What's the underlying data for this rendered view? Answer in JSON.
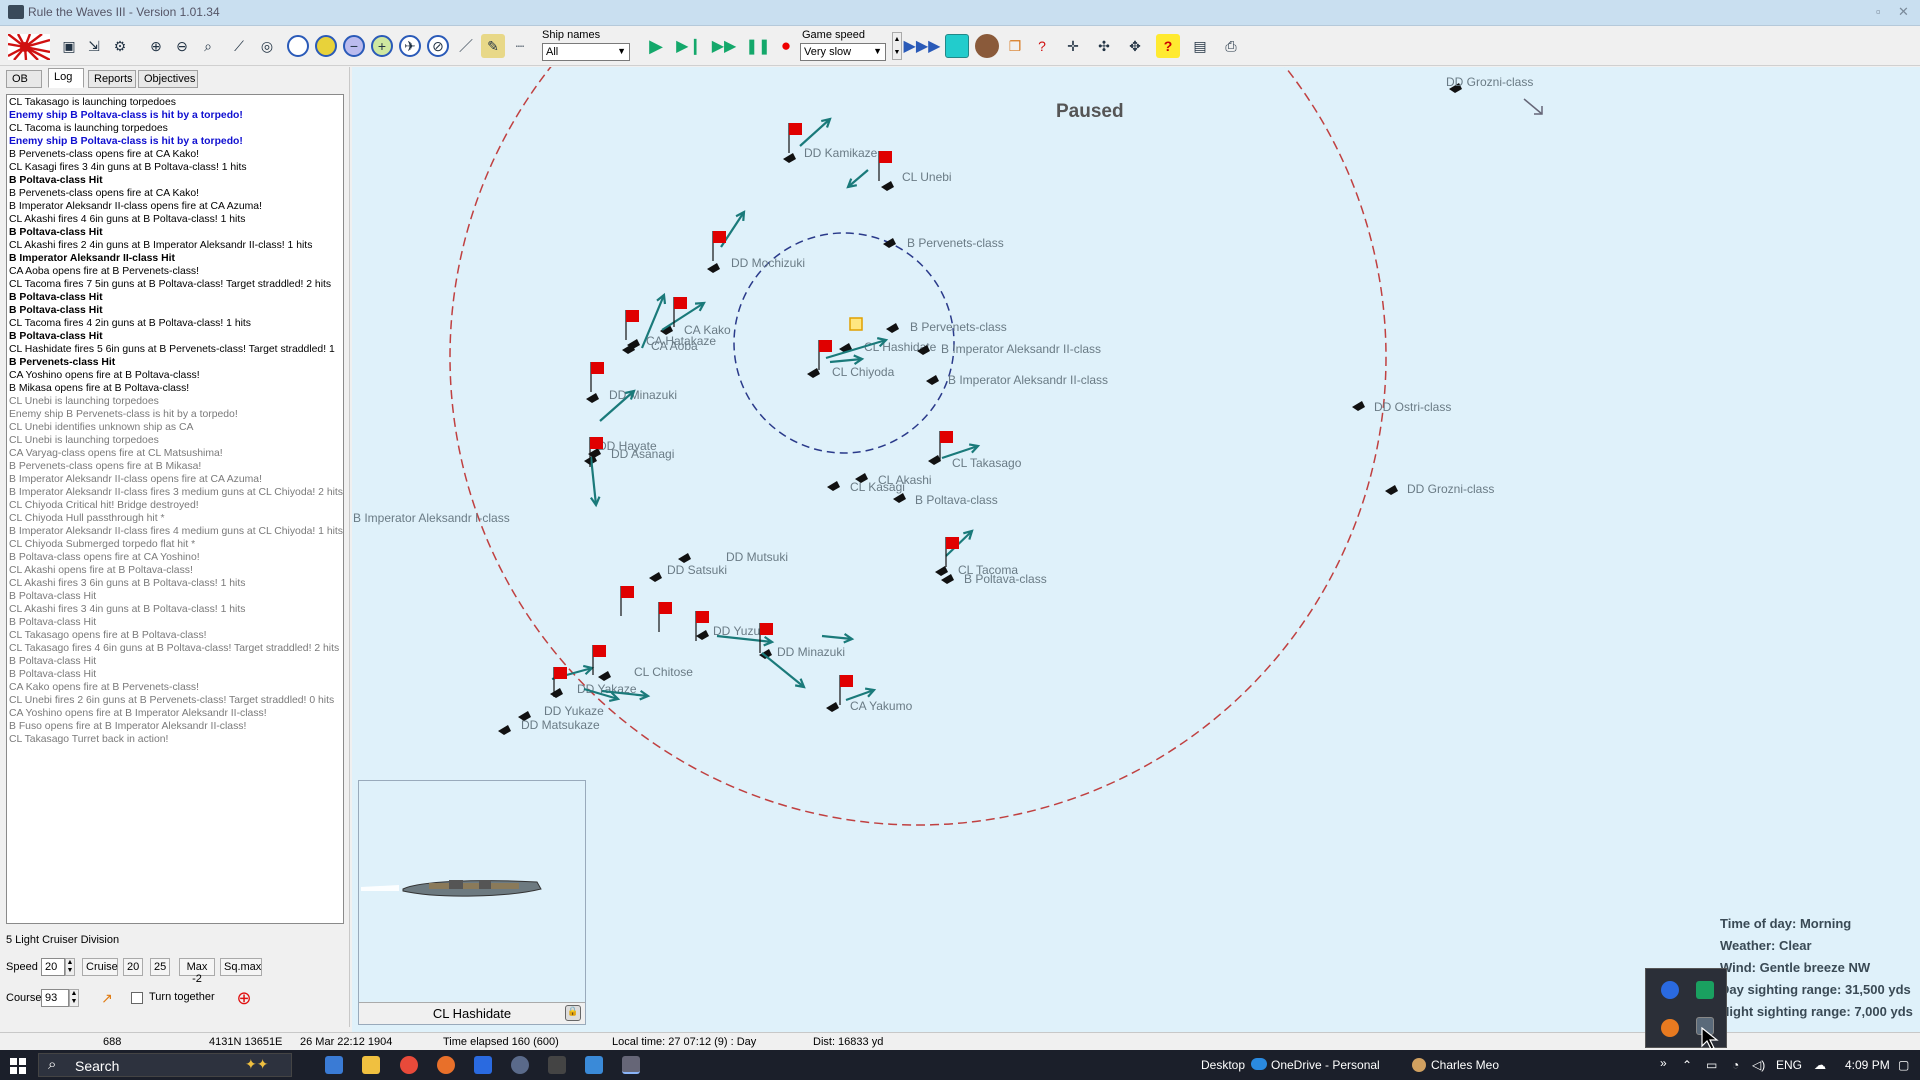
{
  "window": {
    "title": "Rule the Waves III - Version 1.01.34"
  },
  "toolbar": {
    "ship_names_label": "Ship names",
    "ship_names_value": "All",
    "game_speed_label": "Game speed",
    "game_speed_value": "Very slow"
  },
  "tabs": [
    {
      "label": "OB"
    },
    {
      "label": "Log"
    },
    {
      "label": "Reports"
    },
    {
      "label": "Objectives"
    }
  ],
  "log": [
    {
      "text": "CL Takasago is launching torpedoes",
      "style": "normal"
    },
    {
      "text": "Enemy ship B Poltava-class is hit by a torpedo!",
      "style": "blue"
    },
    {
      "text": "CL Tacoma is launching torpedoes",
      "style": "normal"
    },
    {
      "text": "Enemy ship B Poltava-class is hit by a torpedo!",
      "style": "blue"
    },
    {
      "text": "B Pervenets-class opens fire at CA Kako!",
      "style": "normal"
    },
    {
      "text": "CL Kasagi fires 3 4in guns at B Poltava-class! 1 hits",
      "style": "normal"
    },
    {
      "text": "B Poltava-class Hit",
      "style": "bold"
    },
    {
      "text": "B Pervenets-class opens fire at CA Kako!",
      "style": "normal"
    },
    {
      "text": "B Imperator Aleksandr II-class opens fire at CA Azuma!",
      "style": "normal"
    },
    {
      "text": "CL Akashi fires 4 6in guns at B Poltava-class! 1 hits",
      "style": "normal"
    },
    {
      "text": "B Poltava-class Hit",
      "style": "bold"
    },
    {
      "text": "CL Akashi fires 2 4in guns at B Imperator Aleksandr II-class! 1 hits",
      "style": "normal"
    },
    {
      "text": "B Imperator Aleksandr II-class Hit",
      "style": "bold"
    },
    {
      "text": "CA Aoba opens fire at B Pervenets-class!",
      "style": "normal"
    },
    {
      "text": "CL Tacoma fires 7 5in guns at B Poltava-class! Target straddled!  2 hits",
      "style": "normal"
    },
    {
      "text": "B Poltava-class Hit",
      "style": "bold"
    },
    {
      "text": "B Poltava-class Hit",
      "style": "bold"
    },
    {
      "text": "CL Tacoma fires 4 2in guns at B Poltava-class! 1 hits",
      "style": "normal"
    },
    {
      "text": "B Poltava-class Hit",
      "style": "bold"
    },
    {
      "text": "CL Hashidate fires 5 6in guns at B Pervenets-class! Target straddled!  1",
      "style": "normal"
    },
    {
      "text": "B Pervenets-class Hit",
      "style": "bold"
    },
    {
      "text": "CA Yoshino opens fire at B Poltava-class!",
      "style": "normal"
    },
    {
      "text": "B Mikasa opens fire at B Poltava-class!",
      "style": "normal"
    },
    {
      "text": "CL Unebi is launching torpedoes",
      "style": "grey"
    },
    {
      "text": "Enemy ship B Pervenets-class is hit by a torpedo!",
      "style": "grey"
    },
    {
      "text": "CL Unebi identifies unknown ship as CA",
      "style": "grey"
    },
    {
      "text": "CL Unebi is launching torpedoes",
      "style": "grey"
    },
    {
      "text": "CA Varyag-class opens fire at CL Matsushima!",
      "style": "grey"
    },
    {
      "text": "B Pervenets-class opens fire at B Mikasa!",
      "style": "grey"
    },
    {
      "text": "B Imperator Aleksandr II-class opens fire at CA Azuma!",
      "style": "grey"
    },
    {
      "text": "B Imperator Aleksandr II-class fires 3 medium guns at CL Chiyoda! 2 hits",
      "style": "grey"
    },
    {
      "text": "CL Chiyoda  Critical hit! Bridge destroyed!",
      "style": "grey"
    },
    {
      "text": "CL Chiyoda Hull passthrough hit *",
      "style": "grey"
    },
    {
      "text": "B Imperator Aleksandr II-class fires 4 medium guns at CL Chiyoda! 1 hits",
      "style": "grey"
    },
    {
      "text": "CL Chiyoda Submerged torpedo flat hit *",
      "style": "grey"
    },
    {
      "text": "B Poltava-class opens fire at CA Yoshino!",
      "style": "grey"
    },
    {
      "text": "CL Akashi opens fire at B Poltava-class!",
      "style": "grey"
    },
    {
      "text": "CL Akashi fires 3 6in guns at B Poltava-class! 1 hits",
      "style": "grey"
    },
    {
      "text": "B Poltava-class Hit",
      "style": "grey"
    },
    {
      "text": "CL Akashi fires 3 4in guns at B Poltava-class! 1 hits",
      "style": "grey"
    },
    {
      "text": "B Poltava-class Hit",
      "style": "grey"
    },
    {
      "text": "CL Takasago opens fire at B Poltava-class!",
      "style": "grey"
    },
    {
      "text": "CL Takasago fires 4 6in guns at B Poltava-class! Target straddled!  2 hits",
      "style": "grey"
    },
    {
      "text": "B Poltava-class Hit",
      "style": "grey"
    },
    {
      "text": "B Poltava-class Hit",
      "style": "grey"
    },
    {
      "text": "CA Kako opens fire at B Pervenets-class!",
      "style": "grey"
    },
    {
      "text": "CL Unebi fires 2 6in guns at B Pervenets-class! Target straddled!  0 hits",
      "style": "grey"
    },
    {
      "text": "CA Yoshino opens fire at B Imperator Aleksandr II-class!",
      "style": "grey"
    },
    {
      "text": "B Fuso opens fire at B Imperator Aleksandr II-class!",
      "style": "grey"
    },
    {
      "text": "CL Takasago Turret back in action!",
      "style": "grey"
    }
  ],
  "division": {
    "name": "5 Light Cruiser Division",
    "speed_label": "Speed",
    "speed_value": "20",
    "cruise_label": "Cruise",
    "speed_20": "20",
    "speed_25": "25",
    "max_label": "Max -2",
    "sqmax_label": "Sq.max",
    "course_label": "Course",
    "course_value": "93",
    "turn_together_label": "Turn together"
  },
  "map": {
    "paused_label": "Paused",
    "ships": [
      {
        "name": "DD Grozni-class"
      },
      {
        "name": "DD Kamikaze"
      },
      {
        "name": "CL Unebi"
      },
      {
        "name": "B Pervenets-class"
      },
      {
        "name": "DD Mochizuki"
      },
      {
        "name": "CA Kako"
      },
      {
        "name": "CA Hatakaze"
      },
      {
        "name": "CA Aoba"
      },
      {
        "name": "B Pervenets-class"
      },
      {
        "name": "CL Hashidate"
      },
      {
        "name": "B Imperator Aleksandr II-class"
      },
      {
        "name": "CL Chiyoda"
      },
      {
        "name": "B Imperator Aleksandr II-class"
      },
      {
        "name": "DD Minazuki"
      },
      {
        "name": "DD Ostri-class"
      },
      {
        "name": "CL Takasago"
      },
      {
        "name": "DD Hayate"
      },
      {
        "name": "DD Asanagi"
      },
      {
        "name": "CL Akashi"
      },
      {
        "name": "CL Kasagi"
      },
      {
        "name": "B Poltava-class"
      },
      {
        "name": "DD Grozni-class"
      },
      {
        "name": "B Imperator Aleksandr I-class"
      },
      {
        "name": "DD Mutsuki"
      },
      {
        "name": "DD Satsuki"
      },
      {
        "name": "CL Tacoma"
      },
      {
        "name": "B Poltava-class"
      },
      {
        "name": "DD Yuzuki"
      },
      {
        "name": "DD Minazuki"
      },
      {
        "name": "CL Chitose"
      },
      {
        "name": "DD Yakaze"
      },
      {
        "name": "CA Yakumo"
      },
      {
        "name": "DD Yukaze"
      },
      {
        "name": "DD Matsukaze"
      }
    ],
    "weather": {
      "time_of_day": "Time of day: Morning",
      "weather": "Weather: Clear",
      "wind": "Wind: Gentle breeze  NW",
      "day_range": "Day sighting range: 31,500 yds",
      "night_range": "Night sighting range: 7,000 yds"
    }
  },
  "preview": {
    "caption": "CL Hashidate"
  },
  "statusbar": {
    "turn": "688",
    "position": "4131N 13651E",
    "date": "26 Mar 22:12 1904",
    "elapsed": "Time elapsed 160 (600)",
    "local_time": "Local time: 27 07:12 (9) : Day",
    "dist": "Dist: 16833 yd"
  },
  "taskbar": {
    "search_placeholder": "Search",
    "desktop_label": "Desktop",
    "onedrive_label": "OneDrive - Personal",
    "user_label": "Charles Meo",
    "language": "ENG",
    "clock": "4:09 PM"
  },
  "colors": {
    "sea": "#dff1fa",
    "range_ring": "#c04040",
    "inner_ring": "#2a3a8a",
    "course_arrow": "#1a7a7a",
    "enemy_flag": "#e00000"
  }
}
